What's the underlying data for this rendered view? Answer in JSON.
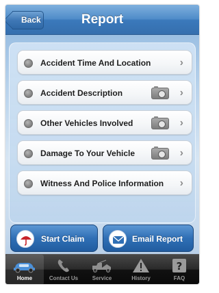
{
  "header": {
    "title": "Report",
    "back_label": "Back"
  },
  "menu": {
    "items": [
      {
        "label": "Accident Time And Location",
        "camera": false
      },
      {
        "label": "Accident Description",
        "camera": true
      },
      {
        "label": "Other Vehicles Involved",
        "camera": true
      },
      {
        "label": "Damage To Your Vehicle",
        "camera": true
      },
      {
        "label": "Witness And Police Information",
        "camera": false
      }
    ]
  },
  "actions": {
    "start_claim": "Start Claim",
    "email_report": "Email Report"
  },
  "tabbar": {
    "tabs": [
      {
        "label": "Home",
        "icon": "car-icon",
        "active": true
      },
      {
        "label": "Contact Us",
        "icon": "phone-icon",
        "active": false
      },
      {
        "label": "Service",
        "icon": "tow-truck-icon",
        "active": false
      },
      {
        "label": "History",
        "icon": "warning-icon",
        "active": false
      },
      {
        "label": "FAQ",
        "icon": "question-icon",
        "active": false
      }
    ]
  },
  "colors": {
    "nav_blue": "#4f8cc9",
    "button_blue": "#2f6fb5",
    "umbrella_red": "#c8242a"
  }
}
